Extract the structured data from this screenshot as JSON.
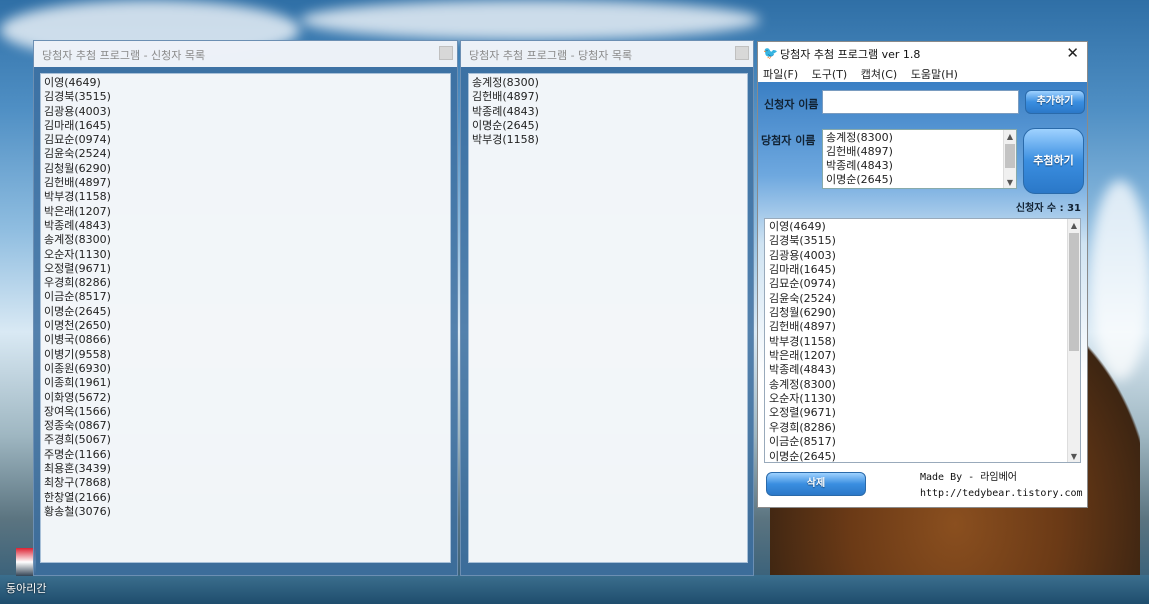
{
  "window_left": {
    "title": "당첨자 추첨 프로그램 - 신청자 목록",
    "items": [
      "이영(4649)",
      "김경북(3515)",
      "김광용(4003)",
      "김마래(1645)",
      "김묘순(0974)",
      "김윤숙(2524)",
      "김청월(6290)",
      "김헌배(4897)",
      "박부경(1158)",
      "박은래(1207)",
      "박종례(4843)",
      "송계정(8300)",
      "오순자(1130)",
      "오정렬(9671)",
      "우경희(8286)",
      "이금순(8517)",
      "이명순(2645)",
      "이명천(2650)",
      "이병국(0866)",
      "이병기(9558)",
      "이종원(6930)",
      "이종희(1961)",
      "이화영(5672)",
      "장여옥(1566)",
      "정종숙(0867)",
      "주경희(5067)",
      "주명순(1166)",
      "최용혼(3439)",
      "최창구(7868)",
      "한창열(2166)",
      "황송철(3076)"
    ]
  },
  "window_mid": {
    "title": "당첨자 추첨 프로그램  - 당첨자 목록",
    "items": [
      "송계정(8300)",
      "김헌배(4897)",
      "박종례(4843)",
      "이명순(2645)",
      "박부경(1158)"
    ]
  },
  "app": {
    "title": "당첨자 추첨 프로그램 ver 1.8",
    "menu": [
      "파일(F)",
      "도구(T)",
      "캡쳐(C)",
      "도움말(H)"
    ],
    "applicant_name_label": "신청자 이름",
    "winner_name_label": "당첨자 이름",
    "add_button": "추가하기",
    "draw_button": "추첨하기",
    "delete_button": "삭제",
    "applicant_count": "신청자 수 : 31",
    "winners": [
      "송계정(8300)",
      "김헌배(4897)",
      "박종례(4843)",
      "이명순(2645)"
    ],
    "applicants": [
      "이영(4649)",
      "김경북(3515)",
      "김광용(4003)",
      "김마래(1645)",
      "김묘순(0974)",
      "김윤숙(2524)",
      "김청월(6290)",
      "김헌배(4897)",
      "박부경(1158)",
      "박은래(1207)",
      "박종례(4843)",
      "송계정(8300)",
      "오순자(1130)",
      "오정렬(9671)",
      "우경희(8286)",
      "이금순(8517)",
      "이명순(2645)"
    ],
    "credit_line1": "Made By - 라임베어",
    "credit_line2": "http://tedybear.tistory.com"
  },
  "taskbar": {
    "label": "동아리간"
  }
}
